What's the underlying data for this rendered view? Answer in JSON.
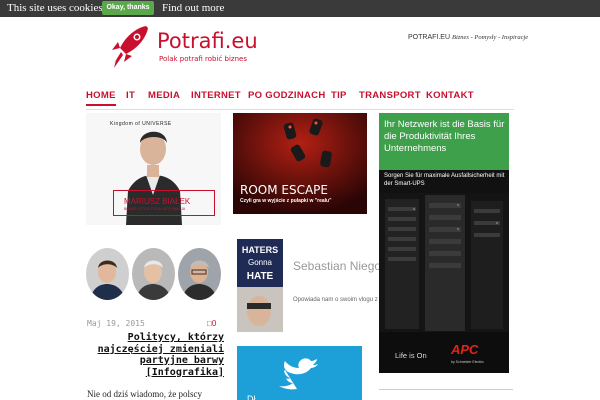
{
  "cookie_bar": {
    "text": "This site uses cookies",
    "accept_label": "Okay, thanks",
    "more_link": "Find out more"
  },
  "header": {
    "logo_title": "Potrafi.eu",
    "logo_tagline": "Polak potrafi robić biznes",
    "site_name": "POTRAFI.EU",
    "slogan": "Biznes - Pomysły - Inspiracje"
  },
  "nav": {
    "items": [
      "HOME",
      "IT",
      "MEDIA",
      "INTERNET",
      "PO GODZINACH",
      "TIP",
      "TRANSPORT",
      "KONTAKT"
    ],
    "active": "HOME"
  },
  "profile": {
    "brand": "Kingdom of UNIVERSE",
    "name": "MARIUSZ BIAŁEK",
    "caption": "BIZNES, STYLE ŻYCIA, MOTYWACJA"
  },
  "post": {
    "date": "Maj 19, 2015",
    "comments": "0",
    "title": "Politycy, którzy najczęściej zmieniali partyjne barwy [Infografika]",
    "excerpt": "Nie od dziś wiadomo, że polscy"
  },
  "room_escape": {
    "title": "ROOM ESCAPE",
    "subtitle": "Czyli gra w wyjście z pułapki w \"realu\""
  },
  "vlog": {
    "badge_line1": "HATERS",
    "badge_line2": "Gonna",
    "badge_line3": "HATE",
    "name": "Sebastian Niegowski",
    "description": "Opowiada nam o swoim vlogu z USA"
  },
  "twitter": {
    "partial_text": "Dł"
  },
  "ad": {
    "headline": "Ihr Netzwerk ist die Basis für die Produktivität Ihres Unternehmens",
    "subtext": "Sorgen Sie für maximale Ausfallsicherheit mit der Smart-UPS",
    "life_is_on": "Life is On",
    "brand": "APC",
    "by": "by Schneider Electric"
  },
  "colors": {
    "brand_red": "#c8102e",
    "cookie_bg": "#3a3a3a",
    "cookie_button": "#5aa84b",
    "ad_green": "#3ea04a",
    "twitter_blue": "#1d9fd7"
  }
}
